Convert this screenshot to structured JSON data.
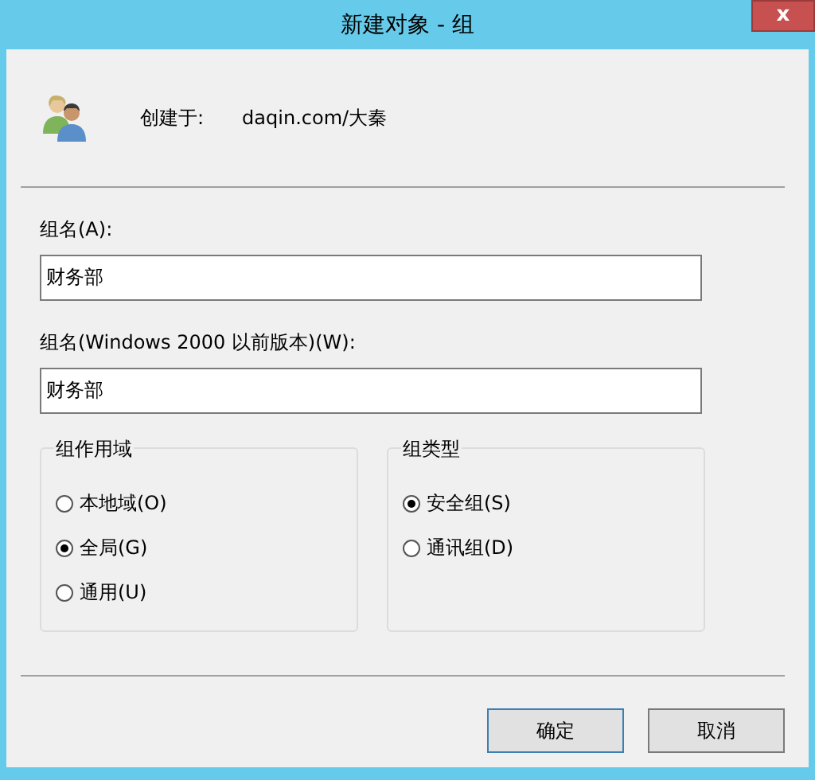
{
  "window": {
    "title": "新建对象 - 组",
    "close": "x"
  },
  "created_in": {
    "label": "创建于:",
    "value": "daqin.com/大秦"
  },
  "fields": [
    {
      "label": "组名(A):",
      "value": "财务部"
    },
    {
      "label": "组名(Windows 2000 以前版本)(W):",
      "value": "财务部"
    }
  ],
  "groups": [
    {
      "title": "组作用域",
      "options": [
        {
          "label": "本地域(O)",
          "selected": false
        },
        {
          "label": "全局(G)",
          "selected": true
        },
        {
          "label": "通用(U)",
          "selected": false
        }
      ]
    },
    {
      "title": "组类型",
      "options": [
        {
          "label": "安全组(S)",
          "selected": true
        },
        {
          "label": "通讯组(D)",
          "selected": false
        }
      ]
    }
  ],
  "buttons": [
    {
      "label": "确定",
      "default": true
    },
    {
      "label": "取消",
      "default": false
    }
  ]
}
